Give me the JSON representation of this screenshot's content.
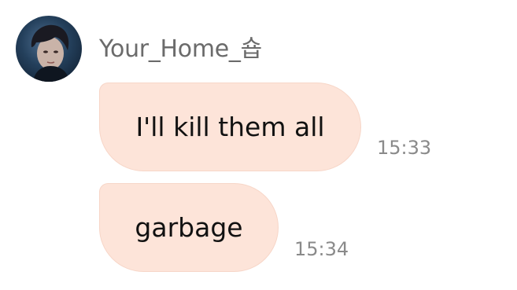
{
  "chat": {
    "sender": {
      "name": "Your_Home_숍",
      "avatar_icon": "profile-photo-avatar"
    },
    "messages": [
      {
        "text": "I'll kill them all",
        "time": "15:33"
      },
      {
        "text": "garbage",
        "time": "15:34"
      }
    ]
  },
  "colors": {
    "bubble_bg": "#fde4d9",
    "bubble_border": "#f7d6c8",
    "name_text": "#6b6b6b",
    "time_text": "#8a8a8a",
    "message_text": "#111111"
  }
}
